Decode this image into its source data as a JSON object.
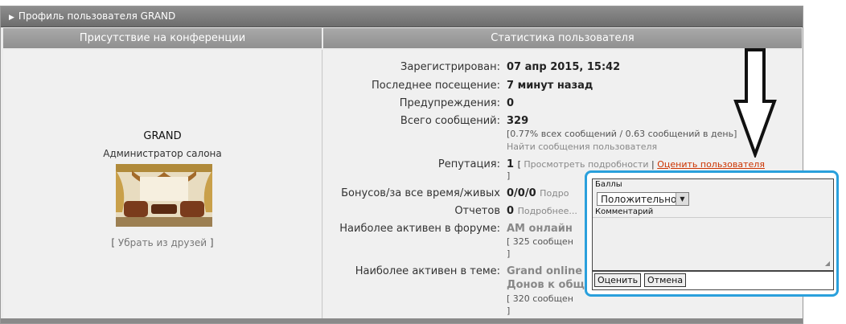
{
  "profile": {
    "title": "Профиль пользователя GRAND",
    "col_left_header": "Присутствие на конференции",
    "col_right_header": "Статистика пользователя"
  },
  "user": {
    "name": "GRAND",
    "role": "Администратор салона",
    "remove_friend": "Убрать из друзей"
  },
  "stats": {
    "registered_label": "Зарегистрирован:",
    "registered_value": "07 апр 2015, 15:42",
    "last_visit_label": "Последнее посещение:",
    "last_visit_value": "7 минут назад",
    "warnings_label": "Предупреждения:",
    "warnings_value": "0",
    "posts_label": "Всего сообщений:",
    "posts_value": "329",
    "posts_sub": "[0.77% всех сообщений / 0.63 сообщений в день]",
    "posts_find": "Найти сообщения пользователя",
    "reputation_label": "Репутация:",
    "reputation_value": "1",
    "reputation_view": "Просмотреть подробности",
    "reputation_rate": "Оценить пользователя",
    "bonus_label": "Бонусов/за все время/живых",
    "bonus_value": "0/0/0",
    "bonus_more": "Подро",
    "reports_label": "Отчетов",
    "reports_value": "0",
    "reports_more": "Подробнее...",
    "active_forum_label": "Наиболее активен в форуме:",
    "active_forum_value": "АМ онлайн",
    "active_forum_sub": "[ 325 сообщен",
    "active_topic_label": "Наиболее активен в теме:",
    "active_topic_value1": "Grand online",
    "active_topic_value2": "Донов к общ",
    "active_topic_sub": "[ 320 сообщен"
  },
  "rate_popup": {
    "points_label": "Баллы",
    "points_selected": "Положительно",
    "comment_label": "Комментарий",
    "submit_label": "Оценить",
    "cancel_label": "Отмена"
  },
  "colors": {
    "popup_border": "#2aa0dc",
    "link_red": "#cc3300",
    "header_bg": "#7d7d7d"
  }
}
